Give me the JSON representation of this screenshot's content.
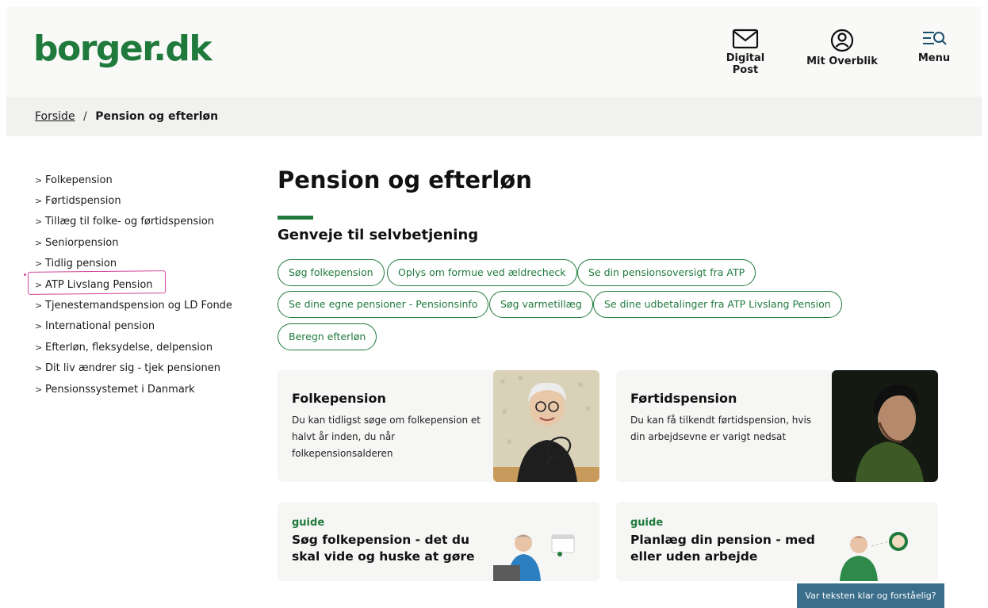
{
  "header": {
    "logo": "borger.dk",
    "digital_post": "Digital Post",
    "mit_overblik": "Mit Overblik",
    "menu": "Menu"
  },
  "breadcrumb": {
    "home": "Forside",
    "separator": "/",
    "current": "Pension og efterløn"
  },
  "sidebar": {
    "items": [
      {
        "label": "Folkepension"
      },
      {
        "label": "Førtidspension"
      },
      {
        "label": "Tillæg til folke- og førtidspension"
      },
      {
        "label": "Seniorpension"
      },
      {
        "label": "Tidlig pension"
      },
      {
        "label": "ATP Livslang Pension"
      },
      {
        "label": "Tjenestemandspension og LD Fonde"
      },
      {
        "label": "International pension"
      },
      {
        "label": "Efterløn, fleksydelse, delpension"
      },
      {
        "label": "Dit liv ændrer sig - tjek pensionen"
      },
      {
        "label": "Pensionssystemet i Danmark"
      }
    ]
  },
  "main": {
    "title": "Pension og efterløn",
    "shortcuts_title": "Genveje til selvbetjening",
    "shortcuts": [
      {
        "label": "Søg folkepension"
      },
      {
        "label": "Oplys om formue ved ældrecheck"
      },
      {
        "label": "Se din pensionsoversigt fra ATP"
      },
      {
        "label": "Se dine egne pensioner - Pensionsinfo"
      },
      {
        "label": "Søg varmetillæg"
      },
      {
        "label": "Se dine udbetalinger fra ATP Livslang Pension"
      },
      {
        "label": "Beregn efterløn"
      }
    ],
    "cards": [
      {
        "title": "Folkepension",
        "text": [
          "Du kan tidligst søge om folkepension et",
          "halvt år inden, du når",
          "folkepensionsalderen"
        ]
      },
      {
        "title": "Førtidspension",
        "text": [
          "Du kan få tilkendt førtidspension, hvis",
          "din arbejdsevne er varigt nedsat"
        ]
      }
    ],
    "guides": [
      {
        "tag": "guide",
        "title": [
          "Søg folkepension - det du",
          "skal vide og huske at gøre"
        ]
      },
      {
        "tag": "guide",
        "title": [
          "Planlæg din pension - med",
          "eller uden arbejde"
        ]
      }
    ]
  },
  "feedback": "Var teksten klar og forståelig?",
  "colors": {
    "brand_green": "#1f7a3c",
    "feedback_blue": "#3a6e8a",
    "highlight_pink": "#d0469a"
  }
}
